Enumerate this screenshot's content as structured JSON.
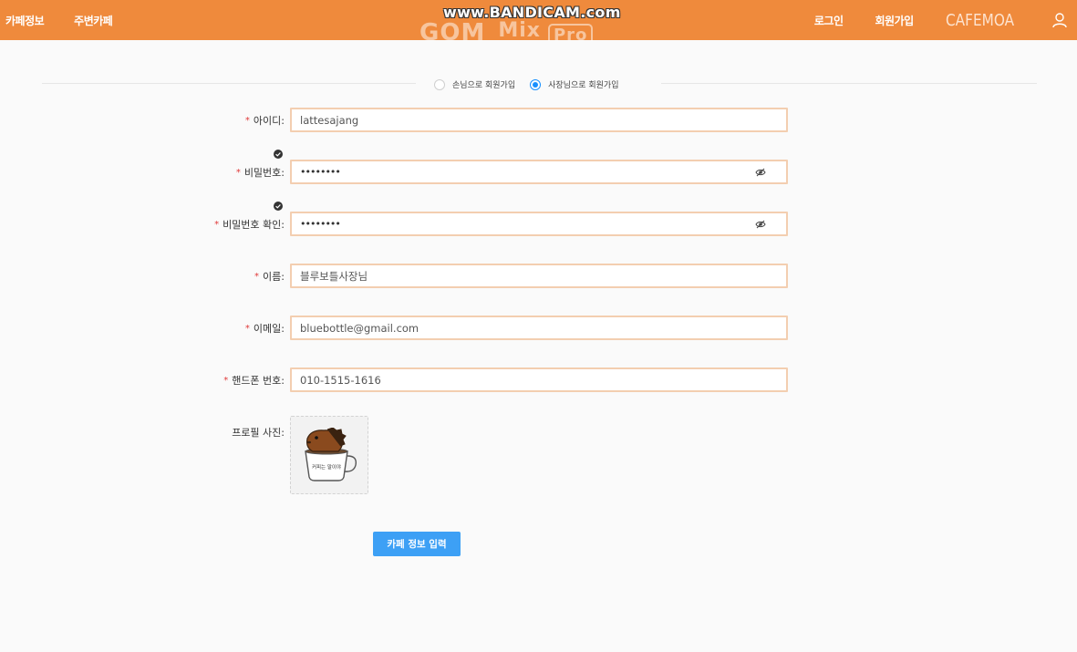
{
  "header": {
    "nav_left": [
      "카페정보",
      "주변카페"
    ],
    "nav_right": [
      "로그인",
      "회원가입"
    ],
    "logo": "CAFEMOA",
    "user_icon": "user-icon",
    "background": "#ef8a3c"
  },
  "watermark": {
    "top": "www.BANDICAM.com",
    "bottom": "GOM",
    "mix": "Mix",
    "pro": "Pro"
  },
  "signup_type": {
    "options": [
      "손님으로 회원가입",
      "사장님으로 회원가입"
    ],
    "selected": "사장님으로 회원가입"
  },
  "form": {
    "id": {
      "label": "아이디:",
      "value": "lattesajang"
    },
    "password": {
      "label": "비밀번호:",
      "value": "••••••••"
    },
    "password_confirm": {
      "label": "비밀번호 확인:",
      "value": "••••••••"
    },
    "name": {
      "label": "이름:",
      "value": "블루보틀사장님"
    },
    "email": {
      "label": "이메일:",
      "value": "bluebottle@gmail.com"
    },
    "phone": {
      "label": "핸드폰 번호:",
      "value": "010-1515-1616"
    },
    "photo": {
      "label": "프로필 사진:",
      "caption": "커피는 말이야"
    },
    "required_mark": "*"
  },
  "submit": {
    "label": "카페 정보 입력",
    "color": "#3da0f5"
  }
}
